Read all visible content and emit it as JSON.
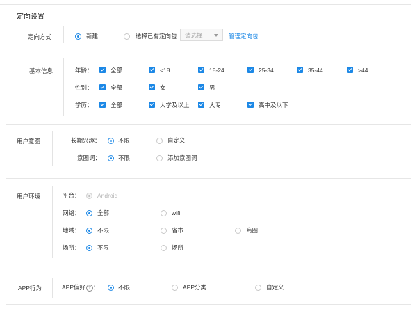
{
  "targeting": {
    "title": "定向设置",
    "method": {
      "label": "定向方式",
      "opt_new": "新建",
      "opt_existing": "选择已有定向包",
      "select_placeholder": "请选择",
      "manage_link": "管理定向包"
    },
    "basic": {
      "label": "基本信息",
      "age_label": "年龄：",
      "ages": [
        "全部",
        "<18",
        "18-24",
        "25-34",
        "35-44",
        ">44"
      ],
      "gender_label": "性别：",
      "genders": [
        "全部",
        "女",
        "男"
      ],
      "edu_label": "学历：",
      "edus": [
        "全部",
        "大学及以上",
        "大专",
        "高中及以下"
      ]
    }
  },
  "intent": {
    "label": "用户意图",
    "interest_label": "长期兴趣：",
    "interest_opt1": "不限",
    "interest_opt2": "自定义",
    "keyword_label": "意图词：",
    "keyword_opt1": "不限",
    "keyword_opt2": "添加意图词"
  },
  "env": {
    "label": "用户环境",
    "platform_label": "平台：",
    "platform_value": "Android",
    "network_label": "网络：",
    "network_opt1": "全部",
    "network_opt2": "wifi",
    "region_label": "地域：",
    "region_opt1": "不限",
    "region_opt2": "省市",
    "region_opt3": "商圈",
    "place_label": "场所：",
    "place_opt1": "不限",
    "place_opt2": "场所"
  },
  "app": {
    "label": "APP行为",
    "pref_label": "APP偏好",
    "pref_help": "?",
    "pref_colon": "：",
    "opt1": "不限",
    "opt2": "APP分类",
    "opt3": "自定义"
  },
  "colors": {
    "accent": "#1c88e6",
    "divider": "#e6e6e6"
  }
}
